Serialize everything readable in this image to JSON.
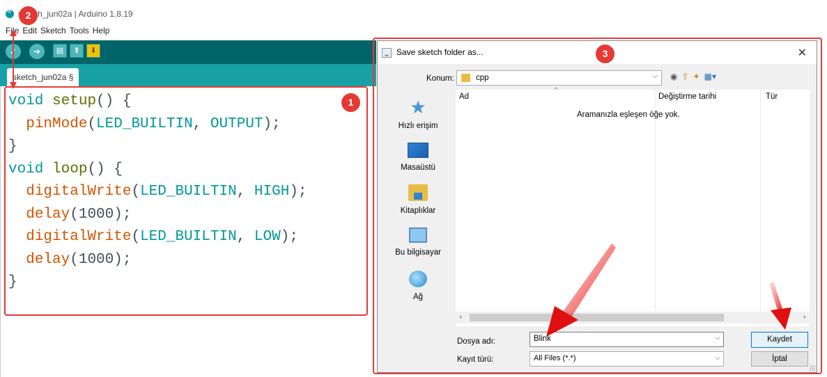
{
  "ide": {
    "window_title": "sketch_jun02a | Arduino 1.8.19",
    "menu": [
      "File",
      "Edit",
      "Sketch",
      "Tools",
      "Help"
    ],
    "toolbar": {
      "verify_icon": "check-icon",
      "upload_icon": "arrow-right-icon",
      "new_icon": "new-file-icon",
      "open_icon": "open-arrow-up-icon",
      "save_icon": "save-arrow-down-icon"
    },
    "tab_label": "sketch_jun02a §",
    "code": {
      "l1_kw": "void",
      "l1_fn": "setup",
      "l1_rest": "() {",
      "l2_fn": "pinMode",
      "l2_open": "(",
      "l2_arg1": "LED_BUILTIN",
      "l2_sep": ", ",
      "l2_arg2": "OUTPUT",
      "l2_close": ");",
      "l3": "}",
      "l4_kw": "void",
      "l4_fn": "loop",
      "l4_rest": "() {",
      "l5_fn": "digitalWrite",
      "l5_open": "(",
      "l5_arg1": "LED_BUILTIN",
      "l5_sep": ", ",
      "l5_arg2": "HIGH",
      "l5_close": ");",
      "l6_fn": "delay",
      "l6_rest": "(1000);",
      "l7_fn": "digitalWrite",
      "l7_open": "(",
      "l7_arg1": "LED_BUILTIN",
      "l7_sep": ", ",
      "l7_arg2": "LOW",
      "l7_close": ");",
      "l8_fn": "delay",
      "l8_rest": "(1000);",
      "l9": "}"
    },
    "colors": {
      "toolbar": "#006468",
      "tabbar": "#17a1a5",
      "keyword": "#00979c",
      "builtin": "#d35400"
    }
  },
  "dialog": {
    "title": "Save sketch folder as...",
    "close_glyph": "✕",
    "location_label": "Konum:",
    "location_value": "cpp",
    "columns": [
      "Ad",
      "Değiştirme tarihi",
      "Tür"
    ],
    "empty_message": "Aramanızla eşleşen öğe yok.",
    "places": [
      "Hızlı erişim",
      "Masaüstü",
      "Kitaplıklar",
      "Bu bilgisayar",
      "Ağ"
    ],
    "filename_label": "Dosya adı:",
    "filename_value": "Blink",
    "filetype_label": "Kayıt türü:",
    "filetype_value": "All Files (*.*)",
    "save_button": "Kaydet",
    "cancel_button": "İptal"
  },
  "annotations": {
    "badges": [
      "1",
      "2",
      "3"
    ],
    "color": "#e53935"
  }
}
